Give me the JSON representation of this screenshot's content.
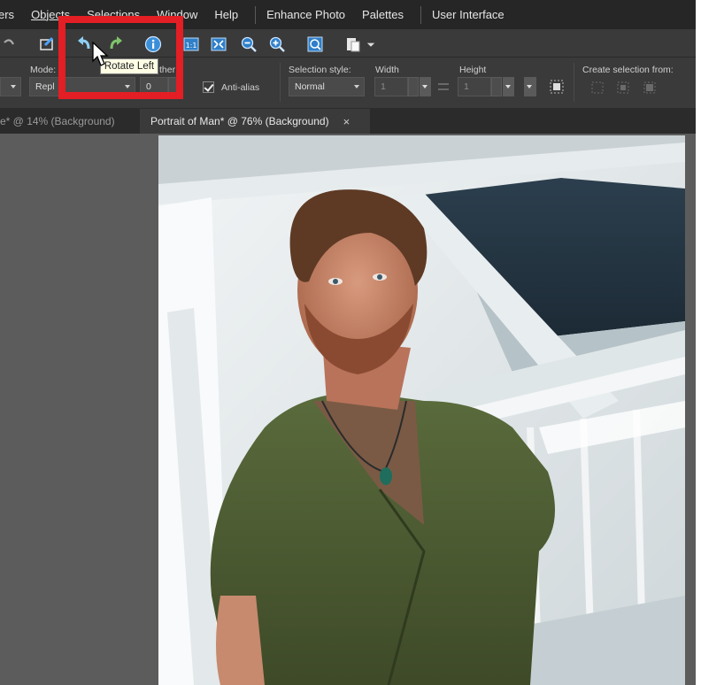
{
  "menubar": {
    "items": [
      "ers",
      "Objects",
      "Selections",
      "Window",
      "Help"
    ],
    "items2": [
      "Enhance Photo",
      "Palettes"
    ],
    "items3": [
      "User Interface"
    ]
  },
  "toolbar": {
    "icons": [
      "redo-icon",
      "crop-icon",
      "rotate-left-icon",
      "rotate-right-icon",
      "info-icon",
      "actual-size-icon",
      "fit-window-icon",
      "zoom-out-icon",
      "zoom-in-icon",
      "zoom-more-icon",
      "paste-icon"
    ]
  },
  "tooltip": {
    "text": "Rotate Left"
  },
  "options": {
    "mode_label": "Mode:",
    "mode_value": "Repl",
    "feather_label": "ther:",
    "feather_value": "0",
    "antialias_label": "Anti-alias",
    "antialias_checked": true,
    "selection_style_label": "Selection style:",
    "selection_style_value": "Normal",
    "width_label": "Width",
    "width_value": "1",
    "height_label": "Height",
    "height_value": "1",
    "create_from_label": "Create selection from:"
  },
  "tabs": [
    {
      "label": "e* @  14% (Background)",
      "active": false
    },
    {
      "label": "Portrait of Man* @  76% (Background)",
      "active": true,
      "close": "×"
    }
  ],
  "colors": {
    "highlight": "#e31e24",
    "menubar_bg": "#262626",
    "toolbar_bg": "#3a3a3a",
    "workspace_bg": "#5c5c5c",
    "icon_blue": "#3b8fd9"
  }
}
